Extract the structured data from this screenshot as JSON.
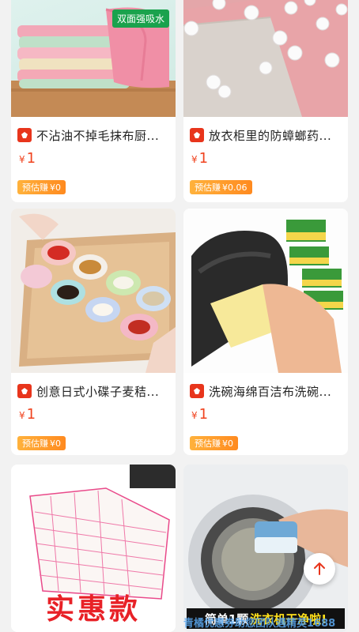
{
  "products": [
    {
      "title": "不沾油不掉毛抹布厨...",
      "currency": "¥",
      "price": "1",
      "earn_label": "预估赚",
      "earn_value": "¥0",
      "image_tag": "双面强吸水"
    },
    {
      "title": "放衣柜里的防蟑螂药...",
      "currency": "¥",
      "price": "1",
      "earn_label": "预估赚",
      "earn_value": "¥0.06"
    },
    {
      "title": "创意日式小碟子麦秸...",
      "currency": "¥",
      "price": "1",
      "earn_label": "预估赚",
      "earn_value": "¥0"
    },
    {
      "title": "洗碗海绵百洁布洗碗...",
      "currency": "¥",
      "price": "1",
      "earn_label": "预估赚",
      "earn_value": "¥0"
    },
    {
      "image_banner": "实惠款"
    },
    {
      "image_banner_white": "简单1颗",
      "image_banner_yellow": "洗衣机干净啦!"
    }
  ],
  "watermark": "青橘优惠券助您团队遇精英1688",
  "colors": {
    "price": "#f0431f",
    "shop_icon": "#e8351c",
    "earn_badge": "#ff9a2a"
  }
}
